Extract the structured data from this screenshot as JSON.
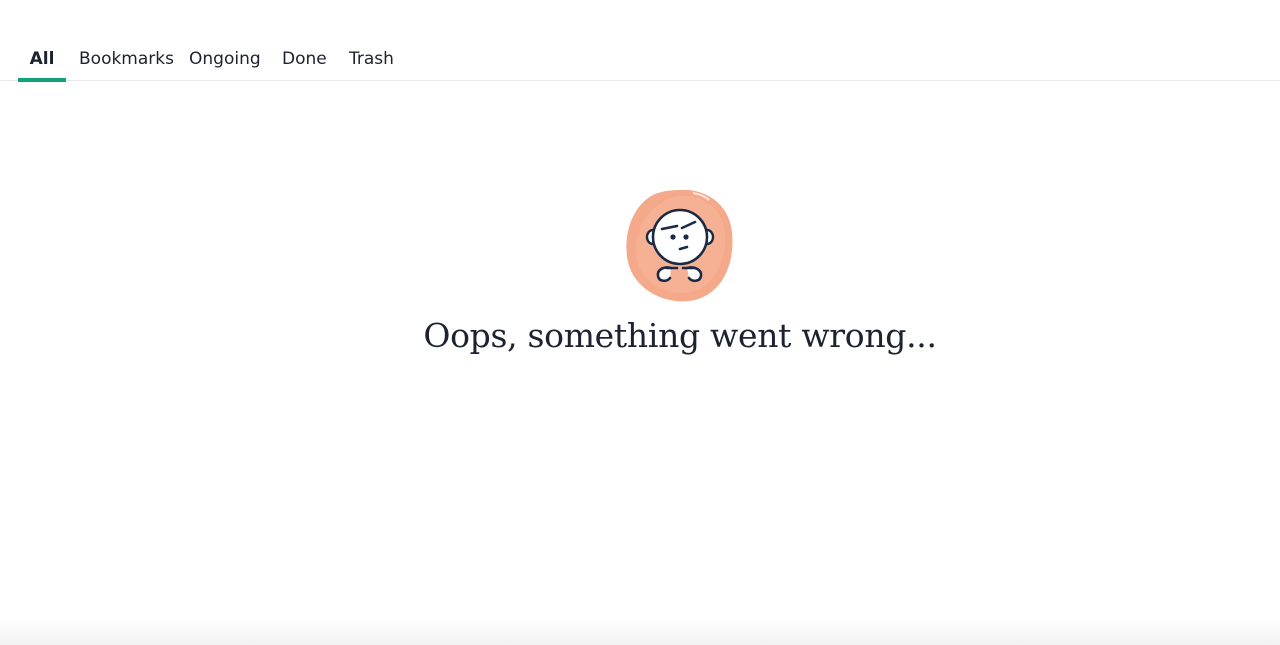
{
  "tabs": [
    {
      "label": "All",
      "active": true
    },
    {
      "label": "Bookmarks",
      "active": false
    },
    {
      "label": "Ongoing",
      "active": false
    },
    {
      "label": "Done",
      "active": false
    },
    {
      "label": "Trash",
      "active": false
    }
  ],
  "colors": {
    "active_tab_indicator": "#15a07f",
    "illustration_blob": "#f4a98a",
    "text": "#1c2230"
  },
  "error": {
    "illustration_icon": "confused-face-icon",
    "message": "Oops, something went wrong..."
  }
}
